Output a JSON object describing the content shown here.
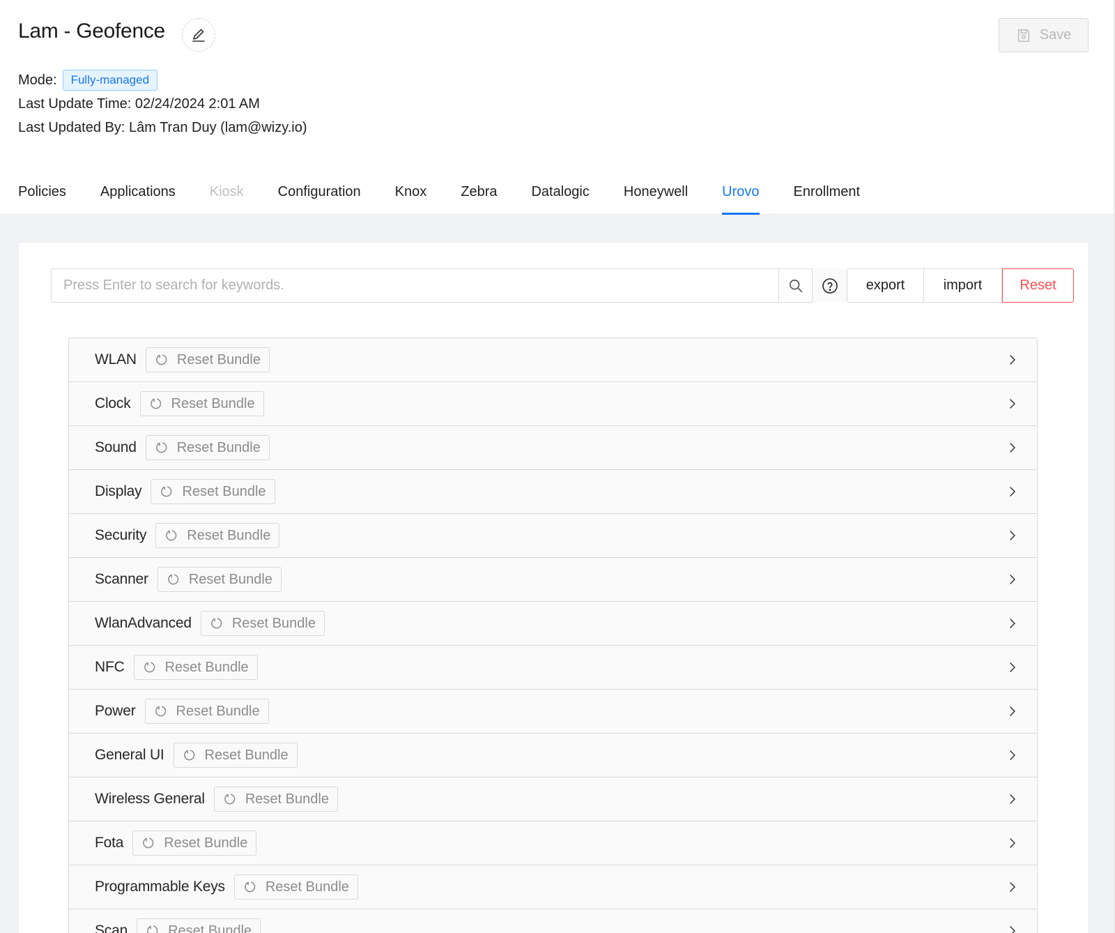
{
  "header": {
    "title": "Lam - Geofence",
    "save_label": "Save",
    "mode_label": "Mode:",
    "mode_value": "Fully-managed",
    "last_update_time": "Last Update Time: 02/24/2024 2:01 AM",
    "last_updated_by": "Last Updated By: Lâm Tran Duy (lam@wizy.io)"
  },
  "tabs": [
    {
      "label": "Policies",
      "state": "normal"
    },
    {
      "label": "Applications",
      "state": "normal"
    },
    {
      "label": "Kiosk",
      "state": "disabled"
    },
    {
      "label": "Configuration",
      "state": "normal"
    },
    {
      "label": "Knox",
      "state": "normal"
    },
    {
      "label": "Zebra",
      "state": "normal"
    },
    {
      "label": "Datalogic",
      "state": "normal"
    },
    {
      "label": "Honeywell",
      "state": "normal"
    },
    {
      "label": "Urovo",
      "state": "active"
    },
    {
      "label": "Enrollment",
      "state": "normal"
    }
  ],
  "toolbar": {
    "search_placeholder": "Press Enter to search for keywords.",
    "export_label": "export",
    "import_label": "import",
    "reset_label": "Reset"
  },
  "bundles": {
    "reset_label": "Reset Bundle",
    "items": [
      "WLAN",
      "Clock",
      "Sound",
      "Display",
      "Security",
      "Scanner",
      "WlanAdvanced",
      "NFC",
      "Power",
      "General UI",
      "Wireless General",
      "Fota",
      "Programmable Keys",
      "Scan"
    ]
  },
  "colors": {
    "primary": "#1677ff",
    "danger": "#ff4d4f",
    "tag_bg": "#e6f4ff",
    "tag_border": "#91caff"
  }
}
